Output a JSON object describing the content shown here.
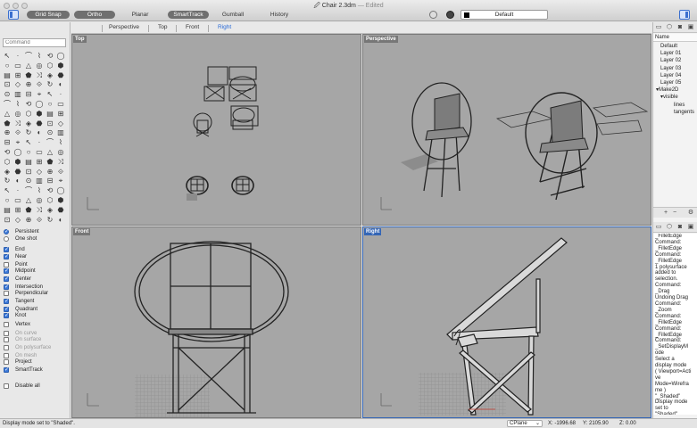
{
  "window": {
    "title": "Chair 2.3dm",
    "edited": "— Edited"
  },
  "toolbar": {
    "grid_snap": "Grid Snap",
    "ortho": "Ortho",
    "planar": "Planar",
    "smarttrack": "SmartTrack",
    "gumball": "Gumball",
    "history": "History",
    "layer": "Default"
  },
  "viewport_tabs": [
    "Perspective",
    "Top",
    "Front",
    "Right"
  ],
  "viewport_tab_selected": "Right",
  "command": {
    "placeholder": "Command"
  },
  "viewports": {
    "top": "Top",
    "perspective": "Perspective",
    "front": "Front",
    "right": "Right"
  },
  "osnaps": [
    {
      "label": "Persistent",
      "checked": true,
      "kind": "radio"
    },
    {
      "label": "One shot",
      "checked": false,
      "kind": "radio"
    },
    {
      "label": "End",
      "checked": true
    },
    {
      "label": "Near",
      "checked": true
    },
    {
      "label": "Point",
      "checked": false
    },
    {
      "label": "Midpoint",
      "checked": true
    },
    {
      "label": "Center",
      "checked": true
    },
    {
      "label": "Intersection",
      "checked": true
    },
    {
      "label": "Perpendicular",
      "checked": false
    },
    {
      "label": "Tangent",
      "checked": true
    },
    {
      "label": "Quadrant",
      "checked": true
    },
    {
      "label": "Knot",
      "checked": true
    },
    {
      "label": "Vertex",
      "checked": false
    },
    {
      "label": "On curve",
      "checked": false,
      "dim": true
    },
    {
      "label": "On surface",
      "checked": false,
      "dim": true
    },
    {
      "label": "On polysurface",
      "checked": false,
      "dim": true
    },
    {
      "label": "On mesh",
      "checked": false,
      "dim": true
    },
    {
      "label": "Project",
      "checked": false
    },
    {
      "label": "SmartTrack",
      "checked": true
    },
    {
      "label": "Disable all",
      "checked": false
    }
  ],
  "layers": {
    "header": "Name",
    "items": [
      "Default",
      "Layer 01",
      "Layer 02",
      "Layer 03",
      "Layer 04",
      "Layer 05",
      "Make2D",
      "visible",
      "lines",
      "tangents"
    ]
  },
  "history_lines": [
    "_FilletEdge",
    "Command:",
    "_FilletEdge",
    "Command:",
    "_FilletEdge",
    "1 polysurface",
    "added to",
    "selection.",
    "Command:",
    "_Drag",
    "Undoing Drag",
    "Command:",
    "_Zoom",
    "Command:",
    "_FilletEdge",
    "Command:",
    "_FilletEdge",
    "Command:",
    "_SetDisplayM",
    "ode",
    "Select a",
    "display mode",
    "( Viewport=Acti",
    "ve",
    "Mode=Wirefra",
    "me )",
    "\"_Shaded\"",
    "Display mode",
    "set to",
    "\"Shaded\"."
  ],
  "status": {
    "message": "Display mode set to \"Shaded\".",
    "cplane": "CPlane",
    "x": "X: -1996.68",
    "y": "Y: 2105.90",
    "z": "Z: 0.00"
  },
  "colors": {
    "viewport_bg": "#a6a6a6",
    "accent": "#3466b6",
    "tab_selected": "#2a6ad7"
  }
}
